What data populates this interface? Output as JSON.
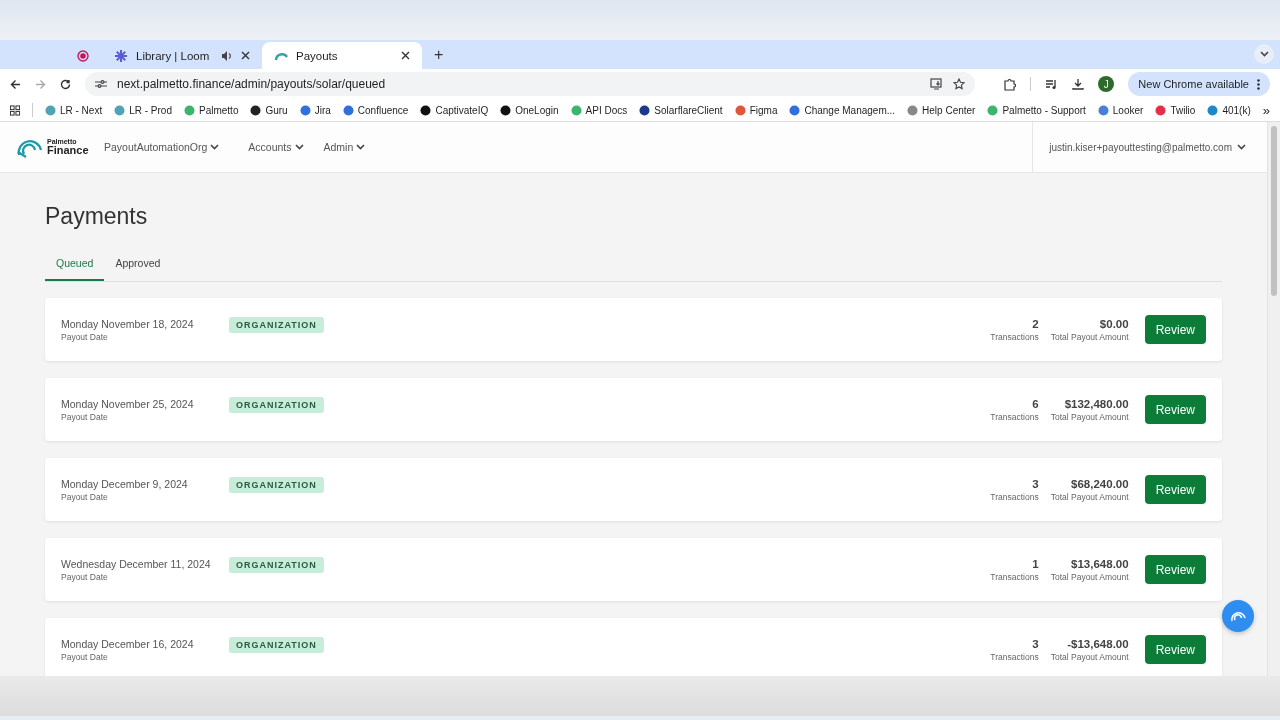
{
  "browser": {
    "tabs": [
      {
        "kind": "recording",
        "selected": false
      },
      {
        "kind": "page",
        "title": "Library | Loom",
        "audio": true,
        "selected": false
      },
      {
        "kind": "page",
        "title": "Payouts",
        "audio": false,
        "selected": true
      }
    ],
    "url": "next.palmetto.finance/admin/payouts/solar/queued",
    "profile_initial": "J",
    "update_button": "New Chrome available",
    "bookmarks": [
      {
        "label": "LR - Next",
        "color": "#4fa3b5"
      },
      {
        "label": "LR - Prod",
        "color": "#4fa3b5"
      },
      {
        "label": "Palmetto",
        "color": "#3cb46e"
      },
      {
        "label": "Guru",
        "color": "#222222"
      },
      {
        "label": "Jira",
        "color": "#2f6fde"
      },
      {
        "label": "Confluence",
        "color": "#2f6fde"
      },
      {
        "label": "CaptivateIQ",
        "color": "#111111"
      },
      {
        "label": "OneLogin",
        "color": "#111111"
      },
      {
        "label": "API Docs",
        "color": "#3cb46e"
      },
      {
        "label": "SolarflareClient",
        "color": "#1b3a8c"
      },
      {
        "label": "Figma",
        "color": "#e2553a"
      },
      {
        "label": "Change Managem...",
        "color": "#2f6fde"
      },
      {
        "label": "Help Center",
        "color": "#888888"
      },
      {
        "label": "Palmetto - Support",
        "color": "#3cb46e"
      },
      {
        "label": "Looker",
        "color": "#4a7fd6"
      },
      {
        "label": "Twilio",
        "color": "#e0304a"
      },
      {
        "label": "401(k)",
        "color": "#1e88c8"
      }
    ],
    "bookmarks_overflow": "»",
    "new_tab": "+"
  },
  "header": {
    "logo_small": "Palmetto",
    "logo_large": "Finance",
    "nav": [
      "PayoutAutomationOrg",
      "Accounts",
      "Admin"
    ],
    "user": "justin.kiser+payouttesting@palmetto.com"
  },
  "page": {
    "title": "Payments",
    "tabs": [
      {
        "label": "Queued",
        "selected": true
      },
      {
        "label": "Approved",
        "selected": false
      }
    ],
    "payouts": [
      {
        "date": "Monday November 18, 2024",
        "date_label": "Payout Date",
        "tag": "ORGANIZATION",
        "count": "2",
        "count_label": "Transactions",
        "amount": "$0.00",
        "amount_label": "Total Payout Amount",
        "button": "Review"
      },
      {
        "date": "Monday November 25, 2024",
        "date_label": "Payout Date",
        "tag": "ORGANIZATION",
        "count": "6",
        "count_label": "Transactions",
        "amount": "$132,480.00",
        "amount_label": "Total Payout Amount",
        "button": "Review"
      },
      {
        "date": "Monday December 9, 2024",
        "date_label": "Payout Date",
        "tag": "ORGANIZATION",
        "count": "3",
        "count_label": "Transactions",
        "amount": "$68,240.00",
        "amount_label": "Total Payout Amount",
        "button": "Review"
      },
      {
        "date": "Wednesday December 11, 2024",
        "date_label": "Payout Date",
        "tag": "ORGANIZATION",
        "count": "1",
        "count_label": "Transactions",
        "amount": "$13,648.00",
        "amount_label": "Total Payout Amount",
        "button": "Review"
      },
      {
        "date": "Monday December 16, 2024",
        "date_label": "Payout Date",
        "tag": "ORGANIZATION",
        "count": "3",
        "count_label": "Transactions",
        "amount": "-$13,648.00",
        "amount_label": "Total Payout Amount",
        "button": "Review"
      }
    ]
  }
}
